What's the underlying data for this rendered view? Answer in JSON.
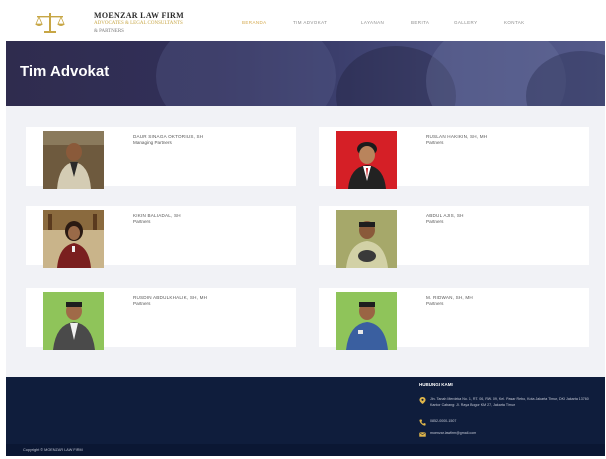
{
  "header": {
    "firm_name": "MOENZAR LAW FIRM",
    "firm_sub": "ADVOCATES & LEGAL CONSULTANTS",
    "firm_sub2": "& PARTNERS",
    "nav": [
      {
        "label": "BERANDA",
        "active": true
      },
      {
        "label": "TIM ADVOKAT",
        "active": false
      },
      {
        "label": "LAYANAN",
        "active": false
      },
      {
        "label": "BERITA",
        "active": false
      },
      {
        "label": "GALLERY",
        "active": false
      },
      {
        "label": "KONTAK",
        "active": false
      }
    ]
  },
  "hero": {
    "title": "Tim Advokat"
  },
  "team": [
    {
      "name": "DAUR SINAGA OKTORIUS, SH",
      "role": "Managing Partners",
      "shirt": "#c9c4b3",
      "bg": "#5d4a32"
    },
    {
      "name": "RUSLAN HAKIKIN, SH, MH",
      "role": "Partners",
      "shirt": "#2b2b2b",
      "bg": "#d51f26"
    },
    {
      "name": "KIKIN BALIADAL, SH",
      "role": "Partners",
      "shirt": "#7a1f1f",
      "bg": "#c9b48a"
    },
    {
      "name": "ABDUL AJIS, SH",
      "role": "Partners",
      "shirt": "#cfd0a8",
      "bg": "#a6a86a"
    },
    {
      "name": "RUSDIN ABDULKHALIK, SH, MH",
      "role": "Partners",
      "shirt": "#4a4a4a",
      "bg": "#8fc45a"
    },
    {
      "name": "M. RIDWAN, SH, MH",
      "role": "Partners",
      "shirt": "#3a5fa0",
      "bg": "#8fc45a"
    }
  ],
  "footer": {
    "heading": "HUBUNGI KAMI",
    "address": "Jln. Tanah Merdeka No. 1, RT. 06, RW. 09, Kel. Pasar Rebo, Kota Jakarta Timur, DKI Jakarta 13760",
    "address2": "Kantor Cabang: Jl. Raya Bogor KM 27, Jakarta Timur",
    "phone": "0852-0000-1507",
    "email": "moenzar.lawfirm@gmail.com",
    "copyright": "Copyright © MOENZAR LAW FIRM"
  },
  "colors": {
    "accent": "#d4a84b",
    "hero": "#32305a",
    "footer": "#0f1d3c"
  }
}
